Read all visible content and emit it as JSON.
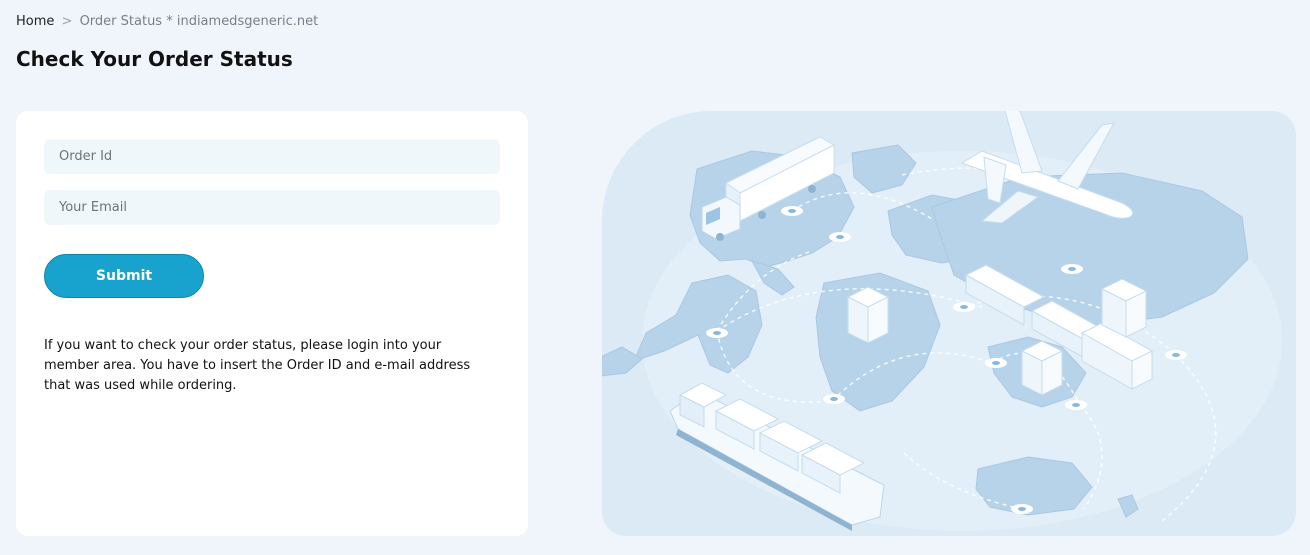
{
  "breadcrumb": {
    "home": "Home",
    "separator": ">",
    "current": "Order Status * indiamedsgeneric.net"
  },
  "page_title": "Check Your Order Status",
  "form": {
    "order_id_placeholder": "Order Id",
    "email_placeholder": "Your Email",
    "submit_label": "Submit",
    "info_text": "If you want to check your order status, please login into your member area. You have to insert the Order ID and e-mail address that was used while ordering."
  },
  "illustration": {
    "icon": "world-logistics-map-illustration"
  },
  "colors": {
    "page_background": "#eff5fa",
    "accent": "#18a3cf",
    "input_background": "#f0f7fb",
    "illustration_background": "#dceaf5"
  }
}
